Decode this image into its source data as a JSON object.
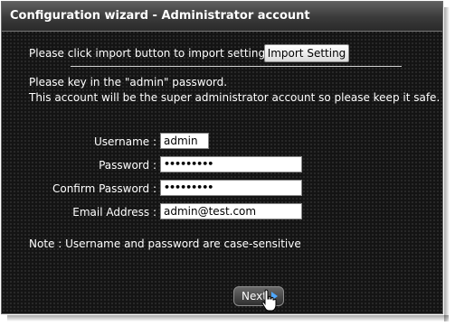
{
  "window": {
    "title": "Configuration wizard - Administrator account"
  },
  "import": {
    "prompt": "Please click import button to import setting:",
    "button_label": "Import Setting"
  },
  "info": {
    "line1": "Please key in the \"admin\" password.",
    "line2": "This account will be the super administrator account so please keep it safe."
  },
  "form": {
    "username": {
      "label": "Username :",
      "value": "admin"
    },
    "password": {
      "label": "Password :",
      "value": "•••••••••"
    },
    "confirm_password": {
      "label": "Confirm Password :",
      "value": "•••••••••"
    },
    "email": {
      "label": "Email Address :",
      "value": "admin@test.com"
    }
  },
  "note": "Note : Username and password are case-sensitive",
  "footer": {
    "next_label": "Next"
  },
  "icons": {
    "next": "arrow-right-icon",
    "cursor": "hand-pointer-icon"
  }
}
